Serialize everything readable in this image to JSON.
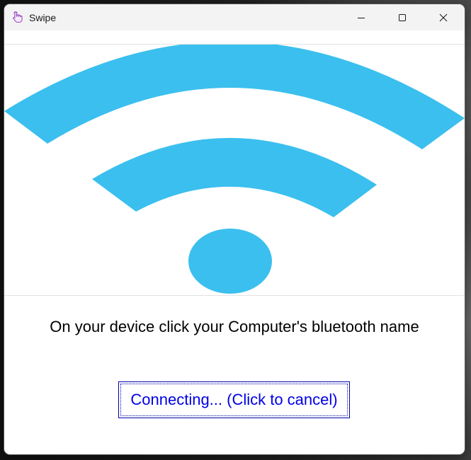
{
  "window": {
    "title": "Swipe",
    "app_icon": "hand-pointer-icon",
    "controls": [
      "minimize-icon",
      "maximize-icon",
      "close-icon"
    ]
  },
  "hero": {
    "icon": "wifi-icon",
    "color": "#3bbfee"
  },
  "main": {
    "message": "On your device click your Computer's bluetooth name",
    "connect_button_label": "Connecting... (Click to cancel)"
  },
  "colors": {
    "accent": "#3bbfee",
    "button_text": "#0000e6",
    "button_border": "#0000a8"
  }
}
